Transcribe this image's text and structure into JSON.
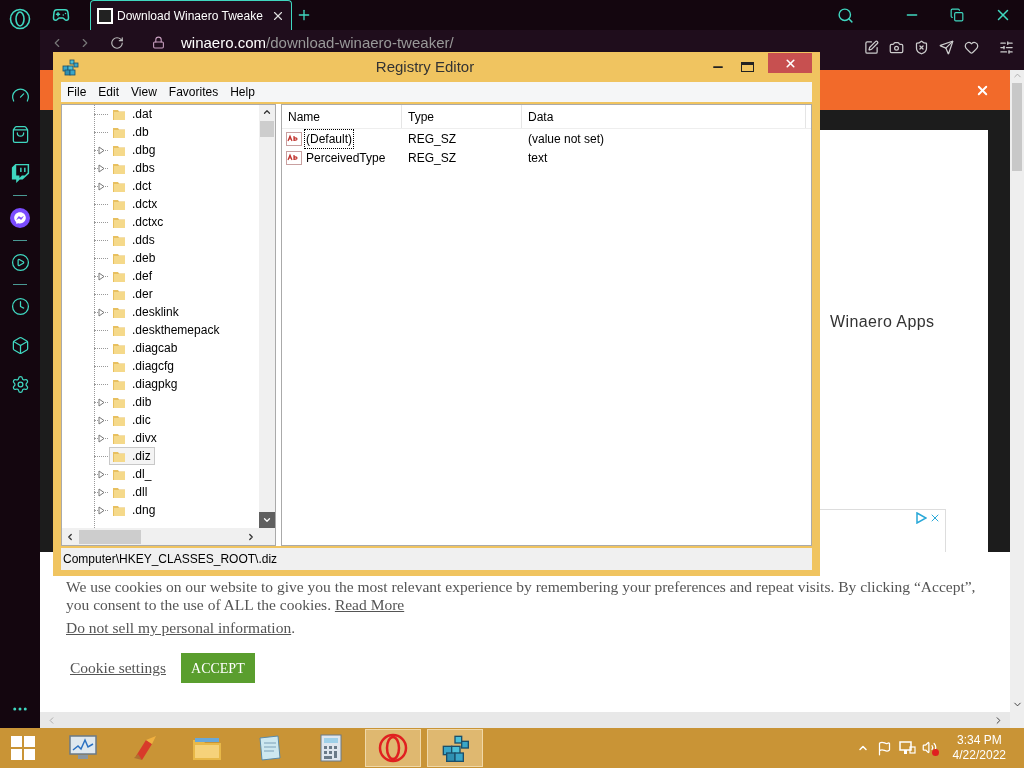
{
  "browser": {
    "tabs": [
      {
        "title": "Download Winaero Tweake",
        "selected": true
      }
    ],
    "url_host": "winaero.com",
    "url_path": "/download-winaero-tweaker/",
    "side_heading": "Winaero Apps",
    "cookie": {
      "text": "We use cookies on our website to give you the most relevant experience by remembering your preferences and repeat visits. By clicking “Accept”, you consent to the use of ALL the cookies.",
      "read_more": "Read More",
      "do_not_sell": "Do not sell my personal information",
      "do_not_sell_end": ".",
      "settings": "Cookie settings",
      "accept": "ACCEPT"
    }
  },
  "registry": {
    "title": "Registry Editor",
    "menu": [
      "File",
      "Edit",
      "View",
      "Favorites",
      "Help"
    ],
    "tree": [
      {
        "label": ".dat",
        "expandable": false,
        "selected": false
      },
      {
        "label": ".db",
        "expandable": false,
        "selected": false
      },
      {
        "label": ".dbg",
        "expandable": true,
        "selected": false
      },
      {
        "label": ".dbs",
        "expandable": true,
        "selected": false
      },
      {
        "label": ".dct",
        "expandable": true,
        "selected": false
      },
      {
        "label": ".dctx",
        "expandable": false,
        "selected": false
      },
      {
        "label": ".dctxc",
        "expandable": false,
        "selected": false
      },
      {
        "label": ".dds",
        "expandable": false,
        "selected": false
      },
      {
        "label": ".deb",
        "expandable": false,
        "selected": false
      },
      {
        "label": ".def",
        "expandable": true,
        "selected": false
      },
      {
        "label": ".der",
        "expandable": false,
        "selected": false
      },
      {
        "label": ".desklink",
        "expandable": true,
        "selected": false
      },
      {
        "label": ".deskthemepack",
        "expandable": false,
        "selected": false
      },
      {
        "label": ".diagcab",
        "expandable": false,
        "selected": false
      },
      {
        "label": ".diagcfg",
        "expandable": false,
        "selected": false
      },
      {
        "label": ".diagpkg",
        "expandable": false,
        "selected": false
      },
      {
        "label": ".dib",
        "expandable": true,
        "selected": false
      },
      {
        "label": ".dic",
        "expandable": true,
        "selected": false
      },
      {
        "label": ".divx",
        "expandable": true,
        "selected": false
      },
      {
        "label": ".diz",
        "expandable": false,
        "selected": true
      },
      {
        "label": ".dl_",
        "expandable": true,
        "selected": false
      },
      {
        "label": ".dll",
        "expandable": true,
        "selected": false
      },
      {
        "label": ".dng",
        "expandable": true,
        "selected": false
      }
    ],
    "columns": [
      "Name",
      "Type",
      "Data"
    ],
    "values": [
      {
        "name": "(Default)",
        "type": "REG_SZ",
        "data": "(value not set)",
        "focused": true
      },
      {
        "name": "PerceivedType",
        "type": "REG_SZ",
        "data": "text",
        "focused": false
      }
    ],
    "status_path": "Computer\\HKEY_CLASSES_ROOT\\.diz"
  },
  "taskbar": {
    "apps": [
      {
        "kind": "monitor",
        "active": false
      },
      {
        "kind": "cleaner",
        "active": false
      },
      {
        "kind": "explorer",
        "active": false
      },
      {
        "kind": "notepad",
        "active": false
      },
      {
        "kind": "calculator",
        "active": false
      },
      {
        "kind": "opera",
        "active": true
      },
      {
        "kind": "regedit",
        "active": true
      }
    ],
    "time": "3:34 PM",
    "date": "4/22/2022"
  }
}
